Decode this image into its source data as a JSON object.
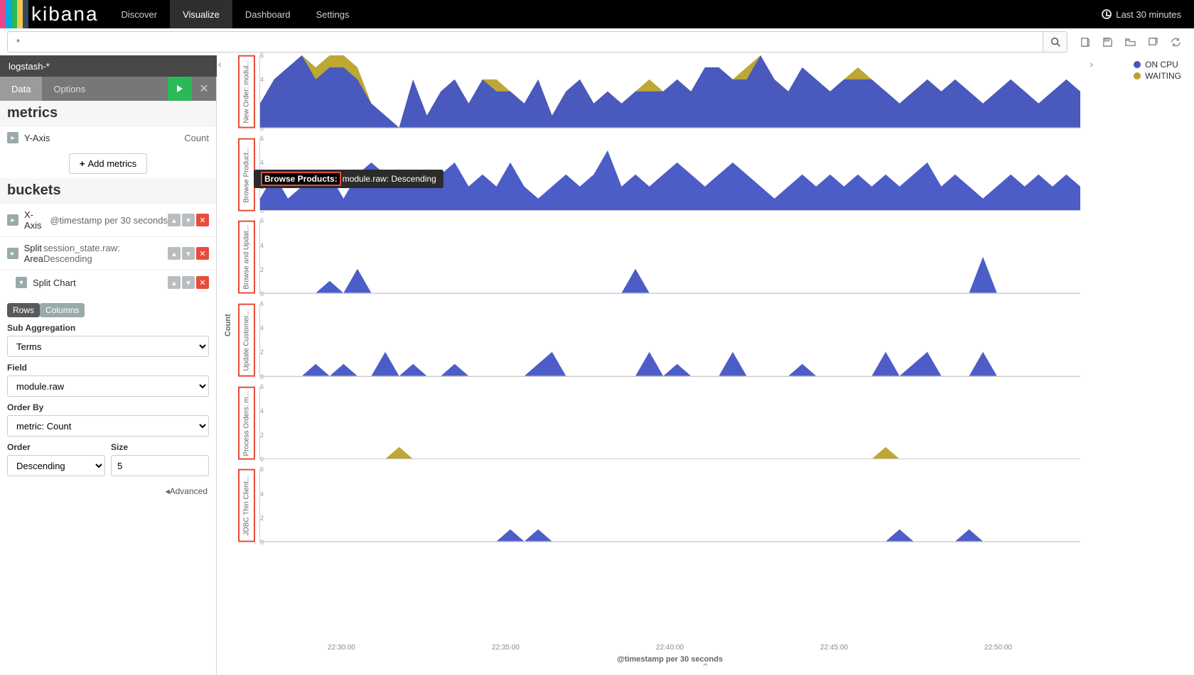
{
  "brand": "kibana",
  "brand_stripes": [
    "#e8478b",
    "#00a9e0",
    "#2bb858",
    "#f2c94c",
    "#34495e"
  ],
  "nav": [
    "Discover",
    "Visualize",
    "Dashboard",
    "Settings"
  ],
  "nav_active": 1,
  "time_label": "Last 30 minutes",
  "query_value": "*",
  "index_pattern": "logstash-*",
  "side_tabs": [
    "Data",
    "Options"
  ],
  "side_tab_active": 0,
  "metrics_head": "metrics",
  "metrics_row": {
    "label": "Y-Axis",
    "value": "Count"
  },
  "add_metrics": "Add metrics",
  "buckets_head": "buckets",
  "bucket_rows": [
    {
      "handle": "▸",
      "label": "X-Axis",
      "value": "@timestamp per 30 seconds",
      "collapsible": true
    },
    {
      "handle": "▸",
      "label": "Split Area",
      "value": "session_state.raw: Descending",
      "collapsible": true
    },
    {
      "handle": "▾",
      "label": "Split Chart",
      "value": "",
      "collapsible": false
    }
  ],
  "rows_columns": {
    "rows": "Rows",
    "cols": "Columns",
    "active": "rows"
  },
  "form": {
    "sub_agg_label": "Sub Aggregation",
    "sub_agg_value": "Terms",
    "field_label": "Field",
    "field_value": "module.raw",
    "orderby_label": "Order By",
    "orderby_value": "metric: Count",
    "order_label": "Order",
    "order_value": "Descending",
    "size_label": "Size",
    "size_value": "5",
    "advanced": "Advanced"
  },
  "legend": [
    {
      "name": "ON CPU",
      "color": "#4254c5"
    },
    {
      "name": "WAITING",
      "color": "#b9a22a"
    }
  ],
  "colors": {
    "cpu": "#4254c5",
    "wait": "#b9a22a"
  },
  "y_axis_label": "Count",
  "x_axis_label": "@timestamp per 30 seconds",
  "x_ticks": [
    "22:30:00",
    "22:35:00",
    "22:40:00",
    "22:45:00",
    "22:50:00"
  ],
  "tooltip": {
    "label": "Browse Products:",
    "rest": "module.raw: Descending"
  },
  "chart_data": [
    {
      "label": "New Order: modul...",
      "ymax": 6,
      "type": "area",
      "series": [
        {
          "name": "WAITING",
          "color": "#b9a22a",
          "values": [
            2,
            4,
            5,
            6,
            5,
            6,
            6,
            5,
            2,
            1,
            0,
            4,
            1,
            3,
            4,
            2,
            4,
            4,
            3,
            2,
            4,
            1,
            3,
            4,
            2,
            3,
            2,
            3,
            4,
            3,
            4,
            3,
            5,
            5,
            4,
            5,
            6,
            4,
            3,
            5,
            4,
            3,
            4,
            5,
            4,
            3,
            2,
            3,
            4,
            3,
            4,
            3,
            2,
            3,
            4,
            3,
            2,
            3,
            4,
            3
          ]
        },
        {
          "name": "ON CPU",
          "color": "#4254c5",
          "values": [
            2,
            4,
            5,
            6,
            4,
            5,
            5,
            4,
            2,
            1,
            0,
            4,
            1,
            3,
            4,
            2,
            4,
            3,
            3,
            2,
            4,
            1,
            3,
            4,
            2,
            3,
            2,
            3,
            3,
            3,
            4,
            3,
            5,
            5,
            4,
            4,
            6,
            4,
            3,
            5,
            4,
            3,
            4,
            4,
            4,
            3,
            2,
            3,
            4,
            3,
            4,
            3,
            2,
            3,
            4,
            3,
            2,
            3,
            4,
            3
          ]
        }
      ]
    },
    {
      "label": "Browse Product...",
      "ymax": 6,
      "type": "area",
      "series": [
        {
          "name": "ON CPU",
          "color": "#4254c5",
          "values": [
            1,
            3,
            1,
            2,
            2,
            3,
            1,
            3,
            4,
            3,
            2,
            3,
            2,
            3,
            4,
            2,
            3,
            2,
            4,
            2,
            1,
            2,
            3,
            2,
            3,
            5,
            2,
            3,
            2,
            3,
            4,
            3,
            2,
            3,
            4,
            3,
            2,
            1,
            2,
            3,
            2,
            3,
            2,
            3,
            2,
            3,
            2,
            3,
            4,
            2,
            3,
            2,
            1,
            2,
            3,
            2,
            3,
            2,
            3,
            2
          ]
        }
      ]
    },
    {
      "label": "Browse and Updat...",
      "ymax": 6,
      "type": "area",
      "series": [
        {
          "name": "ON CPU",
          "color": "#4254c5",
          "values": [
            0,
            0,
            0,
            0,
            0,
            1,
            0,
            2,
            0,
            0,
            0,
            0,
            0,
            0,
            0,
            0,
            0,
            0,
            0,
            0,
            0,
            0,
            0,
            0,
            0,
            0,
            0,
            2,
            0,
            0,
            0,
            0,
            0,
            0,
            0,
            0,
            0,
            0,
            0,
            0,
            0,
            0,
            0,
            0,
            0,
            0,
            0,
            0,
            0,
            0,
            0,
            0,
            3,
            0,
            0,
            0,
            0,
            0,
            0,
            0
          ]
        }
      ]
    },
    {
      "label": "Update Customer...",
      "ymax": 6,
      "type": "area",
      "series": [
        {
          "name": "ON CPU",
          "color": "#4254c5",
          "values": [
            0,
            0,
            0,
            0,
            1,
            0,
            1,
            0,
            0,
            2,
            0,
            1,
            0,
            0,
            1,
            0,
            0,
            0,
            0,
            0,
            1,
            2,
            0,
            0,
            0,
            0,
            0,
            0,
            2,
            0,
            1,
            0,
            0,
            0,
            2,
            0,
            0,
            0,
            0,
            1,
            0,
            0,
            0,
            0,
            0,
            2,
            0,
            1,
            2,
            0,
            0,
            0,
            2,
            0,
            0,
            0,
            0,
            0,
            0,
            0
          ]
        }
      ]
    },
    {
      "label": "Process Orders: m...",
      "ymax": 6,
      "type": "area",
      "series": [
        {
          "name": "WAITING",
          "color": "#b9a22a",
          "values": [
            0,
            0,
            0,
            0,
            0,
            0,
            0,
            0,
            0,
            0,
            1,
            0,
            0,
            0,
            0,
            0,
            0,
            0,
            0,
            0,
            0,
            0,
            0,
            0,
            0,
            0,
            0,
            0,
            0,
            0,
            0,
            0,
            0,
            0,
            0,
            0,
            0,
            0,
            0,
            0,
            0,
            0,
            0,
            0,
            0,
            1,
            0,
            0,
            0,
            0,
            0,
            0,
            0,
            0,
            0,
            0,
            0,
            0,
            0,
            0
          ]
        }
      ]
    },
    {
      "label": "JDBC Thin Client...",
      "ymax": 6,
      "type": "area",
      "series": [
        {
          "name": "ON CPU",
          "color": "#4254c5",
          "values": [
            0,
            0,
            0,
            0,
            0,
            0,
            0,
            0,
            0,
            0,
            0,
            0,
            0,
            0,
            0,
            0,
            0,
            0,
            1,
            0,
            1,
            0,
            0,
            0,
            0,
            0,
            0,
            0,
            0,
            0,
            0,
            0,
            0,
            0,
            0,
            0,
            0,
            0,
            0,
            0,
            0,
            0,
            0,
            0,
            0,
            0,
            1,
            0,
            0,
            0,
            0,
            1,
            0,
            0,
            0,
            0,
            0,
            0,
            0,
            0
          ]
        }
      ]
    }
  ]
}
